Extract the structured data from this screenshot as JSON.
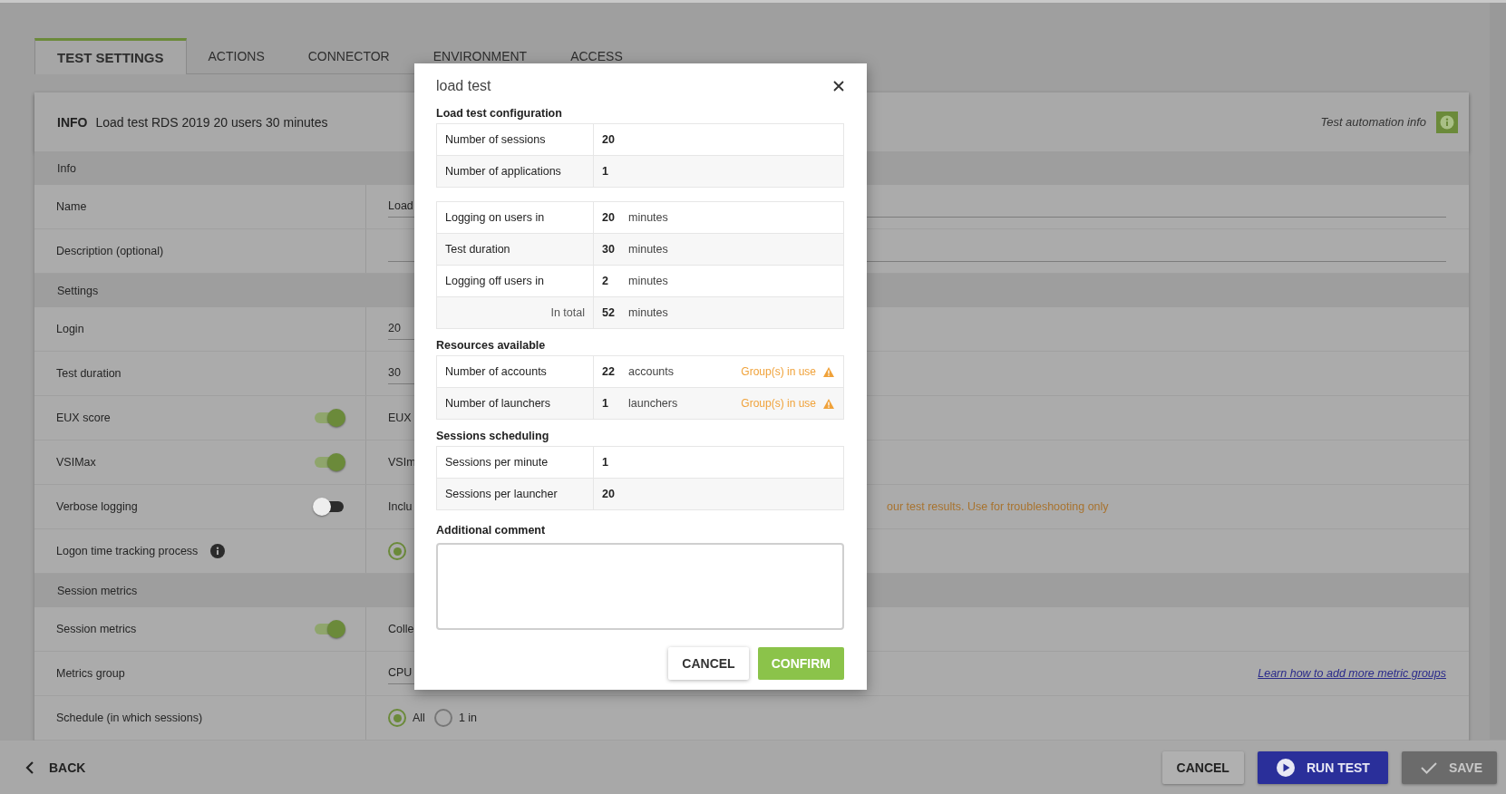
{
  "tabs": [
    {
      "label": "TEST SETTINGS",
      "selected": true
    },
    {
      "label": "ACTIONS",
      "selected": false
    },
    {
      "label": "CONNECTOR",
      "selected": false
    },
    {
      "label": "ENVIRONMENT",
      "selected": false
    },
    {
      "label": "ACCESS",
      "selected": false
    }
  ],
  "info": {
    "heading": "INFO",
    "title": "Load test RDS 2019 20 users 30 minutes",
    "automation_label": "Test automation info"
  },
  "sections": [
    {
      "title": "Info",
      "rows": [
        {
          "kind": "field",
          "label": "Name",
          "value": "Load"
        },
        {
          "kind": "field",
          "label": "Description (optional)"
        }
      ]
    },
    {
      "title": "Settings",
      "rows": [
        {
          "kind": "number",
          "label": "Login",
          "value": "20"
        },
        {
          "kind": "number",
          "label": "Test duration",
          "value": "30"
        },
        {
          "kind": "toggle",
          "label": "EUX score",
          "on": true,
          "value": "EUX"
        },
        {
          "kind": "toggle",
          "label": "VSIMax",
          "on": true,
          "value": "VSIm"
        },
        {
          "kind": "toggle",
          "label": "Verbose logging",
          "on": false,
          "value": "Inclu",
          "note": {
            "kind": "warning",
            "text": "our test results. Use for troubleshooting only"
          }
        },
        {
          "kind": "radio",
          "label": "Logon time tracking process",
          "info_icon": true,
          "options": [
            {
              "selected": true
            }
          ]
        }
      ]
    },
    {
      "title": "Session metrics",
      "rows": [
        {
          "kind": "toggle",
          "label": "Session metrics",
          "on": true,
          "value": "Colle"
        },
        {
          "kind": "number",
          "label": "Metrics group",
          "value": "CPU",
          "note": {
            "kind": "link",
            "text": "Learn how to add more metric groups"
          }
        },
        {
          "kind": "radio",
          "label": "Schedule (in which sessions)",
          "options": [
            {
              "label": "All",
              "selected": true
            },
            {
              "label": "1 in",
              "selected": false
            }
          ]
        }
      ]
    }
  ],
  "footer": {
    "back": "BACK",
    "buttons": [
      {
        "kind": "plain",
        "label": "CANCEL"
      },
      {
        "kind": "primary",
        "label": "RUN TEST"
      },
      {
        "kind": "disabled",
        "label": "SAVE"
      }
    ]
  },
  "modal": {
    "title": "load test",
    "sections": [
      {
        "heading": "Load test configuration",
        "tables": [
          [
            {
              "label": "Number of sessions",
              "value": "20"
            },
            {
              "label": "Number of applications",
              "value": "1"
            }
          ],
          [
            {
              "label": "Logging on users in",
              "value": "20",
              "unit": "minutes"
            },
            {
              "label": "Test duration",
              "value": "30",
              "unit": "minutes"
            },
            {
              "label": "Logging off users in",
              "value": "2",
              "unit": "minutes"
            },
            {
              "label": "In total",
              "value": "52",
              "unit": "minutes",
              "total": true
            }
          ]
        ]
      },
      {
        "heading": "Resources available",
        "tables": [
          [
            {
              "label": "Number of accounts",
              "value": "22",
              "unit": "accounts",
              "warning": "Group(s) in use"
            },
            {
              "label": "Number of launchers",
              "value": "1",
              "unit": "launchers",
              "warning": "Group(s) in use"
            }
          ]
        ]
      },
      {
        "heading": "Sessions scheduling",
        "tables": [
          [
            {
              "label": "Sessions per minute",
              "value": "1"
            },
            {
              "label": "Sessions per launcher",
              "value": "20"
            }
          ]
        ]
      }
    ],
    "comment_label": "Additional comment",
    "buttons": [
      {
        "kind": "plain",
        "label": "CANCEL"
      },
      {
        "kind": "confirm",
        "label": "CONFIRM"
      }
    ]
  }
}
